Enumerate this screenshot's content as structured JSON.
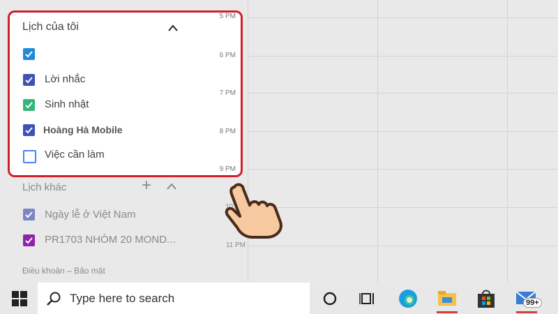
{
  "my_calendars": {
    "title": "Lịch của tôi",
    "items": [
      {
        "label": "",
        "color": "#1f8ad8",
        "checked": true
      },
      {
        "label": "Lời nhắc",
        "color": "#3f51b5",
        "checked": true
      },
      {
        "label": "Sinh nhật",
        "color": "#33b679",
        "checked": true
      },
      {
        "label": "Hoàng Hà Mobile",
        "color": "#3f51b5",
        "checked": true
      },
      {
        "label": "Việc cần làm",
        "color": "#4285f4",
        "checked": false
      }
    ]
  },
  "other_calendars": {
    "title": "Lịch khác",
    "add_symbol": "+",
    "items": [
      {
        "label": "Ngày lễ ở Việt Nam",
        "color": "#7b86c6",
        "checked": true
      },
      {
        "label": "PR1703 NHÓM 20 MOND...",
        "color": "#8e24aa",
        "checked": true
      }
    ]
  },
  "footer": {
    "terms": "Điều khoản",
    "separator": "–",
    "privacy": "Bảo mật"
  },
  "times": [
    "5 PM",
    "6 PM",
    "7 PM",
    "8 PM",
    "9 PM",
    "10 PM",
    "11 PM"
  ],
  "taskbar": {
    "search_placeholder": "Type here to search",
    "mail_badge": "99+",
    "icons": [
      "windows-start-icon",
      "search-icon",
      "cortana-circle-icon",
      "task-view-icon",
      "edge-icon",
      "file-explorer-icon",
      "microsoft-store-icon",
      "mail-icon"
    ]
  },
  "colors": {
    "highlight_border": "#d21e2b"
  }
}
